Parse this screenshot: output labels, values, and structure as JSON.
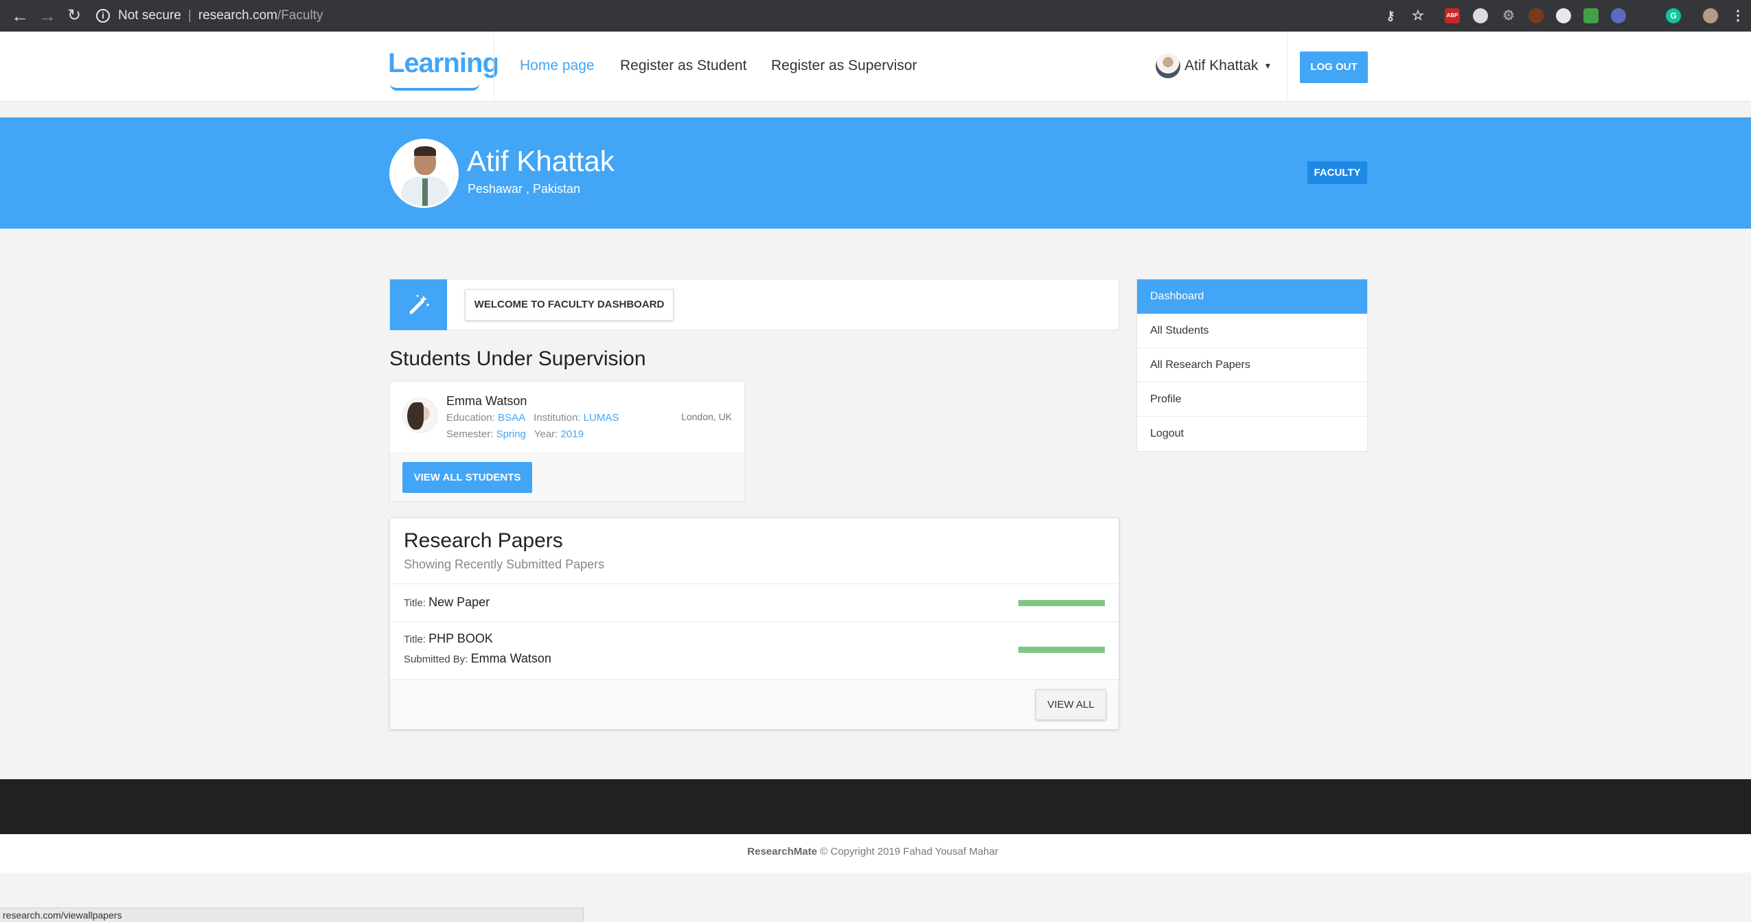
{
  "browser": {
    "security_label": "Not secure",
    "url_host": "research.com",
    "url_path": "/Faculty",
    "extensions": [
      "key-icon",
      "star-icon",
      "abp-icon",
      "extension-icon",
      "settings-icon",
      "extension-icon",
      "extension-icon",
      "extension-icon",
      "extension-icon",
      "grammarly-icon",
      "profile-icon",
      "menu-icon"
    ],
    "abp_label": "ABP"
  },
  "navbar": {
    "logo": "Learning",
    "links": [
      "Home page",
      "Register as Student",
      "Register as Supervisor"
    ],
    "user_name": "Atif Khattak",
    "logout_label": "LOG OUT"
  },
  "profile": {
    "name": "Atif Khattak",
    "location": "Peshawar , Pakistan",
    "role_badge": "FACULTY"
  },
  "welcome": {
    "label": "WELCOME TO FACULTY DASHBOARD"
  },
  "students_section": {
    "title": "Students Under Supervision",
    "students": [
      {
        "name": "Emma Watson",
        "education_label": "Education:",
        "education": "BSAA",
        "institution_label": "Institution:",
        "institution": "LUMAS",
        "semester_label": "Semester:",
        "semester": "Spring",
        "year_label": "Year:",
        "year": "2019",
        "location": "London, UK"
      }
    ],
    "view_all_label": "VIEW ALL STUDENTS"
  },
  "papers_section": {
    "title": "Research Papers",
    "subtitle": "Showing Recently Submitted Papers",
    "title_label": "Title:",
    "submitted_label": "Submitted By:",
    "papers": [
      {
        "title": "New Paper",
        "submitted_by": "",
        "progress": 1.0
      },
      {
        "title": "PHP BOOK",
        "submitted_by": "Emma Watson",
        "progress": 1.0
      }
    ],
    "view_all_label": "VIEW ALL"
  },
  "sidebar": {
    "items": [
      {
        "label": "Dashboard",
        "active": true
      },
      {
        "label": "All Students",
        "active": false
      },
      {
        "label": "All Research Papers",
        "active": false
      },
      {
        "label": "Profile",
        "active": false
      },
      {
        "label": "Logout",
        "active": false
      }
    ]
  },
  "footer": {
    "brand": "ResearchMate",
    "copyright": "© Copyright 2019 Fahad Yousaf Mahar"
  },
  "status_bar": {
    "url": "research.com/viewallpapers"
  },
  "colors": {
    "accent": "#42a5f5",
    "badge": "#1e88e5",
    "progress": "#81c784",
    "footer_dark": "#212121"
  }
}
